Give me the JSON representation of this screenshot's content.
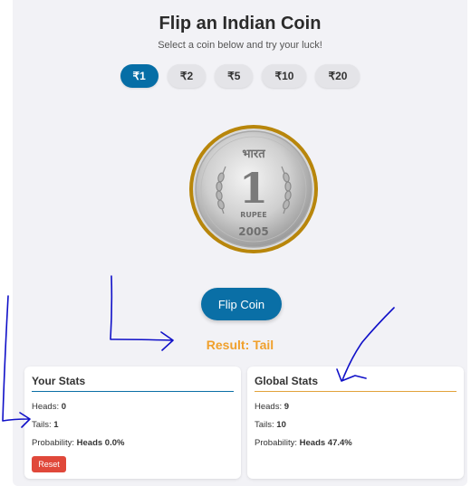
{
  "header": {
    "title": "Flip an Indian Coin",
    "subtitle": "Select a coin below and try your luck!"
  },
  "denominations": [
    {
      "label": "₹1",
      "active": true
    },
    {
      "label": "₹2",
      "active": false
    },
    {
      "label": "₹5",
      "active": false
    },
    {
      "label": "₹10",
      "active": false
    },
    {
      "label": "₹20",
      "active": false
    }
  ],
  "coin": {
    "top_text": "भारत",
    "value": "1",
    "denomination_word": "RUPEE",
    "year": "2005",
    "rim_color": "#b8860b"
  },
  "flip_button": "Flip Coin",
  "result": "Result: Tail",
  "your_stats": {
    "title": "Your Stats",
    "heads_label": "Heads:",
    "heads": "0",
    "tails_label": "Tails:",
    "tails": "1",
    "probability_label": "Probability:",
    "probability": "Heads 0.0%",
    "reset_label": "Reset"
  },
  "global_stats": {
    "title": "Global Stats",
    "heads_label": "Heads:",
    "heads": "9",
    "tails_label": "Tails:",
    "tails": "10",
    "probability_label": "Probability:",
    "probability": "Heads 47.4%"
  },
  "colors": {
    "accent": "#0a6fa6",
    "result": "#f0a02c",
    "reset": "#e0483a",
    "annotation": "#1010c8"
  }
}
